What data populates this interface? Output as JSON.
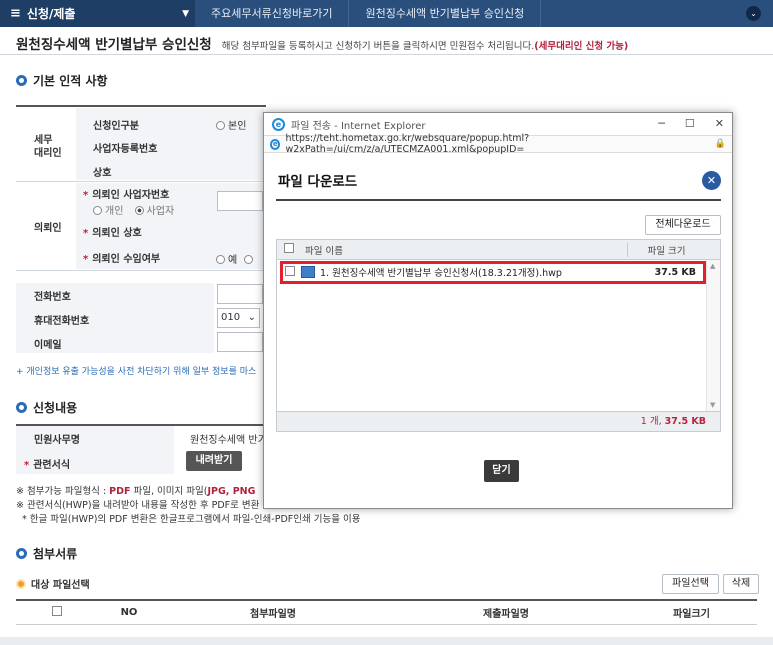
{
  "topbar": {
    "menu": "신청/제출",
    "crumb1": "주요세무서류신청바로가기",
    "crumb2": "원천징수세액 반기별납부 승인신청"
  },
  "page": {
    "title": "원천징수세액 반기별납부 승인신청",
    "desc": "해당 첨부파일을 등록하시고 신청하기 버튼을 클릭하시면 민원접수 처리됩니다.",
    "desc_red": "(세무대리인 신청 가능)"
  },
  "basic": {
    "section": "기본 인적 사항",
    "agent_group": "세무\n대리인",
    "applicant_type": "신청인구분",
    "self": "본인",
    "biz_no": "사업자등록번호",
    "trade_name": "상호",
    "client_group": "의뢰인",
    "client_biz_no": "의뢰인 사업자번호",
    "individual": "개인",
    "business": "사업자",
    "client_trade": "의뢰인 상호",
    "client_accept": "의뢰인 수임여부",
    "yes": "예",
    "phone": "전화번호",
    "mobile": "휴대전화번호",
    "mobile_prefix": "010",
    "email": "이메일",
    "privacy_note": "+ 개인정보 유출 가능성을 사전 차단하기 위해 일부 정보를 마스"
  },
  "apply": {
    "section": "신청내용",
    "service_label": "민원사무명",
    "service_value": "원천징수세액 반기",
    "form_label": "관련서식",
    "download": "내려받기",
    "note1_a": "※ 첨부가능 파일형식 : ",
    "note1_b": "PDF",
    "note1_c": " 파일, 이미지 파일(",
    "note1_d": "JPG, PNG",
    "note2": "※ 관련서식(HWP)을 내려받아 내용을 작성한 후 PDF로 변환",
    "note3": "* 한글 파일(HWP)의 PDF 변환은 한글프로그램에서 파일-인쇄-PDF인쇄 기능을 이용"
  },
  "attach": {
    "section": "첨부서류",
    "target": "대상 파일선택",
    "select_btn": "파일선택",
    "delete_btn": "삭제",
    "columns": [
      "NO",
      "첨부파일명",
      "제출파일명",
      "파일크기"
    ]
  },
  "popup": {
    "window_title": "파일 전송 - Internet Explorer",
    "url": "https://teht.hometax.go.kr/websquare/popup.html?w2xPath=/ui/cm/z/a/UTECMZA001.xml&popupID=",
    "heading": "파일 다운로드",
    "all_download": "전체다운로드",
    "col_name": "파일 이름",
    "col_size": "파일 크기",
    "file_name": "1. 원천징수세액 반기별납부 승인신청서(18.3.21개정).hwp",
    "file_size": "37.5 KB",
    "footer_count": "1 개,",
    "footer_size": "37.5 KB",
    "close": "닫기"
  },
  "colors": {
    "topbar": "#2a4f7c",
    "accent_red": "#e0202c",
    "brand_blue": "#2a6cb6"
  }
}
